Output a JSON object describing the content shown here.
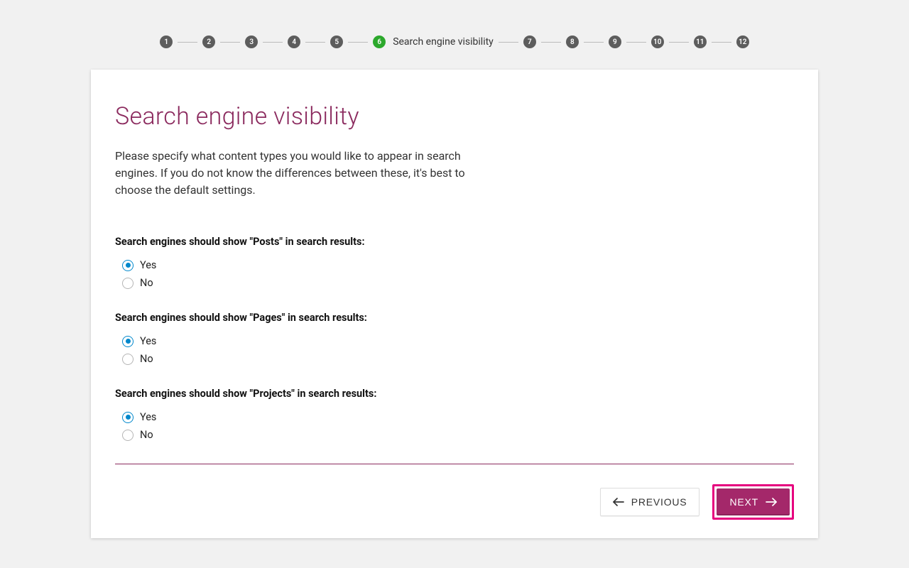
{
  "stepper": {
    "steps": [
      {
        "num": "1",
        "active": false,
        "label": ""
      },
      {
        "num": "2",
        "active": false,
        "label": ""
      },
      {
        "num": "3",
        "active": false,
        "label": ""
      },
      {
        "num": "4",
        "active": false,
        "label": ""
      },
      {
        "num": "5",
        "active": false,
        "label": ""
      },
      {
        "num": "6",
        "active": true,
        "label": "Search engine visibility"
      },
      {
        "num": "7",
        "active": false,
        "label": ""
      },
      {
        "num": "8",
        "active": false,
        "label": ""
      },
      {
        "num": "9",
        "active": false,
        "label": ""
      },
      {
        "num": "10",
        "active": false,
        "label": ""
      },
      {
        "num": "11",
        "active": false,
        "label": ""
      },
      {
        "num": "12",
        "active": false,
        "label": ""
      }
    ]
  },
  "page": {
    "title": "Search engine visibility",
    "description": "Please specify what content types you would like to appear in search engines. If you do not know the differences between these, it's best to choose the default settings."
  },
  "questions": [
    {
      "label": "Search engines should show \"Posts\" in search results:",
      "options": [
        {
          "text": "Yes",
          "checked": true
        },
        {
          "text": "No",
          "checked": false
        }
      ]
    },
    {
      "label": "Search engines should show \"Pages\" in search results:",
      "options": [
        {
          "text": "Yes",
          "checked": true
        },
        {
          "text": "No",
          "checked": false
        }
      ]
    },
    {
      "label": "Search engines should show \"Projects\" in search results:",
      "options": [
        {
          "text": "Yes",
          "checked": true
        },
        {
          "text": "No",
          "checked": false
        }
      ]
    }
  ],
  "actions": {
    "previous": "PREVIOUS",
    "next": "NEXT"
  }
}
